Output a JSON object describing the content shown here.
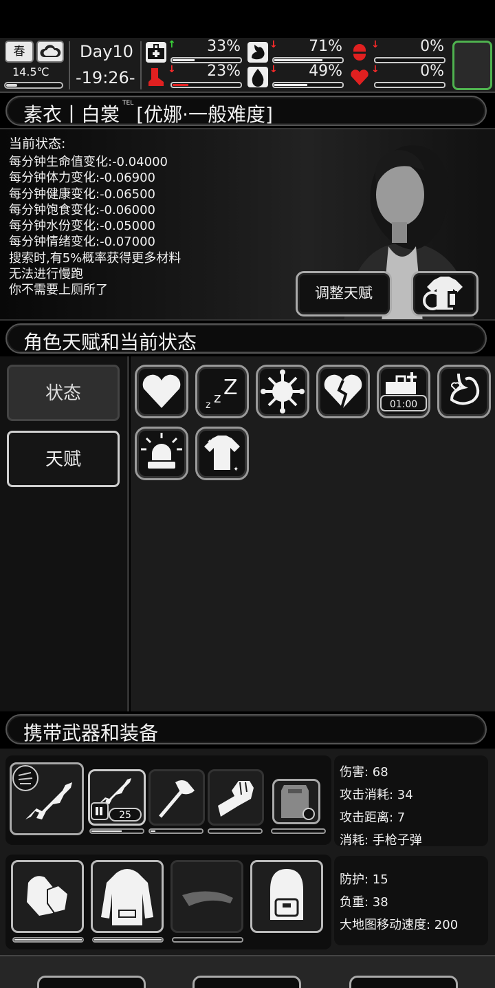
{
  "topbar": {
    "season": "春",
    "weather_icon": "cloud-icon",
    "temperature": "14.5℃",
    "day": "Day10",
    "time": "-19:26-",
    "stats": [
      {
        "id": "health",
        "icon": "medkit-icon",
        "trend": "up",
        "value": "33%",
        "level": 0.33
      },
      {
        "id": "food",
        "icon": "stomach-icon",
        "trend": "down",
        "value": "71%",
        "level": 0.71
      },
      {
        "id": "mood",
        "icon": "pill-icon",
        "trend": "down",
        "value": "0%",
        "level": 0
      },
      {
        "id": "stamina",
        "icon": "boot-icon",
        "trend": "down",
        "value": "23%",
        "level": 0.23
      },
      {
        "id": "water",
        "icon": "water-drop-icon",
        "trend": "down",
        "value": "49%",
        "level": 0.49
      },
      {
        "id": "life",
        "icon": "heart-icon",
        "trend": "down",
        "value": "0%",
        "level": 0
      }
    ]
  },
  "character": {
    "name_line": "素衣丨白裳",
    "tel_mark": "TEL",
    "role_line": "[优娜·一般难度]",
    "status_title": "当前状态:",
    "status_lines": [
      "每分钟生命值变化:-0.04000",
      "每分钟体力变化:-0.06900",
      "每分钟健康变化:-0.06500",
      "每分钟饱食变化:-0.06000",
      "每分钟水份变化:-0.05000",
      "每分钟情绪变化:-0.07000",
      "搜索时,有5%概率获得更多材料",
      "无法进行慢跑",
      "你不需要上厕所了"
    ],
    "adjust_talent_label": "调整天赋"
  },
  "talent_section": {
    "title": "角色天赋和当前状态",
    "tabs": [
      "状态",
      "天赋"
    ],
    "status_icons": [
      "heart-icon",
      "sleep-icon",
      "virus-icon",
      "broken-heart-icon",
      "medkit-timer-icon",
      "stomach-heart-icon",
      "alarm-icon",
      "shirt-icon"
    ],
    "timer_text": "01:00"
  },
  "equipment": {
    "title": "携带武器和装备",
    "ammo_count": "25",
    "weapon_stats": [
      "伤害: 68",
      "攻击消耗: 34",
      "攻击距离: 7",
      "消耗: 手枪子弹"
    ],
    "armor_stats": [
      "防护: 15",
      "负重: 38",
      "大地图移动速度: 200"
    ],
    "weapon_durability": [
      0,
      0.6,
      0.1,
      0,
      0
    ],
    "armor_durability": [
      1,
      1,
      0
    ]
  }
}
